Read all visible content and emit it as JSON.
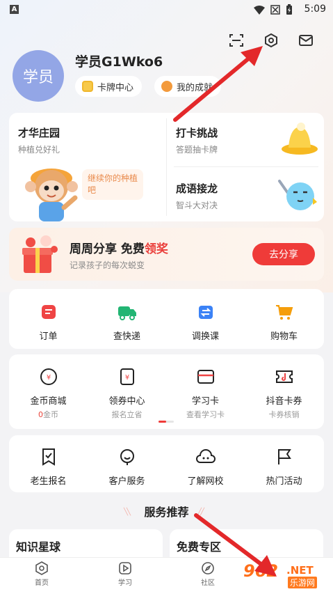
{
  "status_bar": {
    "time": "5:09",
    "indicator": "A"
  },
  "header_icons": [
    "scan-icon",
    "settings-hex-icon",
    "message-envelope-icon"
  ],
  "profile": {
    "avatar_text": "学员",
    "username": "学员G1Wko6",
    "pills": [
      {
        "label": "卡牌中心",
        "icon": "card-icon"
      },
      {
        "label": "我的成就",
        "icon": "medal-icon"
      }
    ]
  },
  "activity_cards": {
    "garden": {
      "title": "才华庄园",
      "subtitle": "种植兑好礼",
      "bubble": "继续你的种植吧"
    },
    "checkin": {
      "title": "打卡挑战",
      "subtitle": "答题抽卡牌"
    },
    "idiom": {
      "title": "成语接龙",
      "subtitle": "智斗大对决"
    }
  },
  "share_banner": {
    "title_a": "周周分享 免费",
    "title_b": "领奖",
    "subtitle": "记录孩子的每次蜕变",
    "button": "去分享"
  },
  "row1": [
    {
      "label": "订单",
      "icon": "order-icon",
      "color": "#ef4444"
    },
    {
      "label": "查快递",
      "icon": "truck-icon",
      "color": "#22b573"
    },
    {
      "label": "调换课",
      "icon": "calendar-swap-icon",
      "color": "#3b82f6"
    },
    {
      "label": "购物车",
      "icon": "cart-icon",
      "color": "#f59e0b"
    }
  ],
  "row2": [
    {
      "label": "金币商城",
      "sub_a": "0",
      "sub_b": "金币",
      "icon": "coin-icon"
    },
    {
      "label": "领券中心",
      "sub": "报名立省",
      "icon": "coupon-icon"
    },
    {
      "label": "学习卡",
      "sub": "查看学习卡",
      "icon": "study-card-icon"
    },
    {
      "label": "抖音卡券",
      "sub": "卡券核销",
      "icon": "douyin-ticket-icon"
    }
  ],
  "row3": [
    {
      "label": "老生报名",
      "icon": "bookmark-icon"
    },
    {
      "label": "客户服务",
      "icon": "headset-icon"
    },
    {
      "label": "了解网校",
      "icon": "cloud-face-icon"
    },
    {
      "label": "热门活动",
      "icon": "flag-icon"
    }
  ],
  "section_title": "服务推荐",
  "recommend": [
    {
      "title": "知识星球"
    },
    {
      "title": "免费专区"
    }
  ],
  "bottom_nav": [
    {
      "label": "首页",
      "icon": "home-hex-icon"
    },
    {
      "label": "学习",
      "icon": "play-icon"
    },
    {
      "label": "社区",
      "icon": "compass-icon"
    }
  ],
  "watermark": {
    "num": "962",
    "net": ".NET",
    "cn": "乐游网"
  },
  "colors": {
    "accent": "#ef3b39",
    "avatar": "#93a6e6"
  }
}
